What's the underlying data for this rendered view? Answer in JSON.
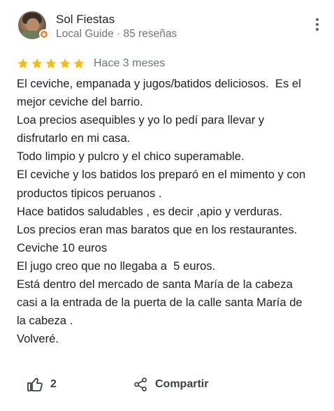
{
  "reviewer": {
    "name": "Sol Fiestas",
    "meta": "Local Guide · 85 reseñas"
  },
  "review": {
    "stars": 5,
    "max_stars": 5,
    "star_color": "#fbbc04",
    "time": "Hace 3 meses",
    "lines": [
      "El ceviche, empanada y jugos/batidos deliciosos.  Es el",
      "mejor ceviche del barrio.",
      "Loa precios asequibles y yo lo pedí para llevar y",
      "disfrutarlo en mi casa.",
      "Todo limpio y pulcro y el chico superamable.",
      "El ceviche y los batidos los preparó en el mimento y con",
      "productos tipicos peruanos .",
      "Hace batidos saludables , es decir ,apio y verduras.",
      "Los precios eran mas baratos que en los restaurantes.",
      "Ceviche 10 euros",
      "El jugo creo que no llegaba a  5 euros.",
      "Está dentro del mercado de santa María de la cabeza",
      "casi a la entrada de la puerta de la calle santa María de",
      "la cabeza .",
      "Volveré."
    ]
  },
  "actions": {
    "like_count": "2",
    "share_label": "Compartir",
    "like_icon": "thumb-up-icon",
    "share_icon": "share-icon"
  },
  "colors": {
    "text": "#202124",
    "secondary": "#70757a",
    "badge": "#f07c24"
  }
}
